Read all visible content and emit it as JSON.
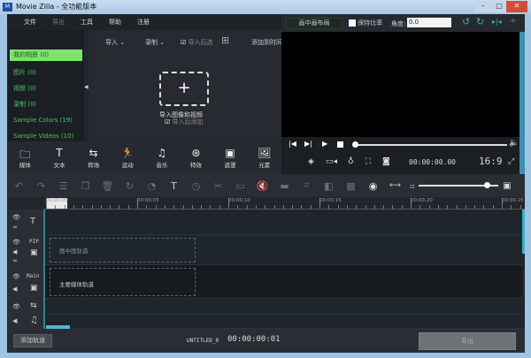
{
  "window": {
    "title": "Movie Zilla - 全功能版本",
    "logo": "M"
  },
  "menu": [
    "文件",
    "导出",
    "工具",
    "帮助",
    "注册"
  ],
  "sidebar": [
    "我的相册 (0)",
    "图片 (0)",
    "视频 (0)",
    "录制 (0)",
    "Sample Colors (19)",
    "Sample Videos (10)"
  ],
  "media": {
    "import": "导入",
    "record": "录制",
    "import_after": "导入后选",
    "add_to_timeline": "添加到时间",
    "drop_label": "导入图像和视频",
    "auto_add": "导入后添加"
  },
  "categories": [
    {
      "icon": "folder-icon",
      "g": "🗀",
      "label": "媒体"
    },
    {
      "icon": "text-icon",
      "g": "T",
      "label": "文本"
    },
    {
      "icon": "transition-icon",
      "g": "⇆",
      "label": "转场"
    },
    {
      "icon": "motion-icon",
      "g": "🏃",
      "label": "运动"
    },
    {
      "icon": "music-icon",
      "g": "♫",
      "label": "音乐"
    },
    {
      "icon": "effects-icon",
      "g": "⊛",
      "label": "特效"
    },
    {
      "icon": "overlay-icon",
      "g": "▣",
      "label": "遮罩"
    },
    {
      "icon": "elements-icon",
      "g": "🖼",
      "label": "元素"
    }
  ],
  "preview": {
    "pip_layout": "画中画布局",
    "keep_ratio": "保持比率",
    "angle_label": "角度:",
    "angle_value": "0.0",
    "timecode": "00:00:00.00",
    "aspect": "16:9",
    "progress": 0
  },
  "ruler": [
    "00:00:00",
    "00:00:05",
    "00:00:10",
    "00:00:15",
    "00:00:20",
    "00:00:25"
  ],
  "tracks": {
    "pip_label": "PIP",
    "main_label": "Main",
    "pip_slot": "画中画轨道",
    "main_slot": "主要媒体轨道"
  },
  "bottom": {
    "add_track": "添加轨道",
    "project": "UNTITLED_0",
    "duration": "00:00:00:01",
    "export": "导出"
  },
  "zoom_level": 0.85
}
